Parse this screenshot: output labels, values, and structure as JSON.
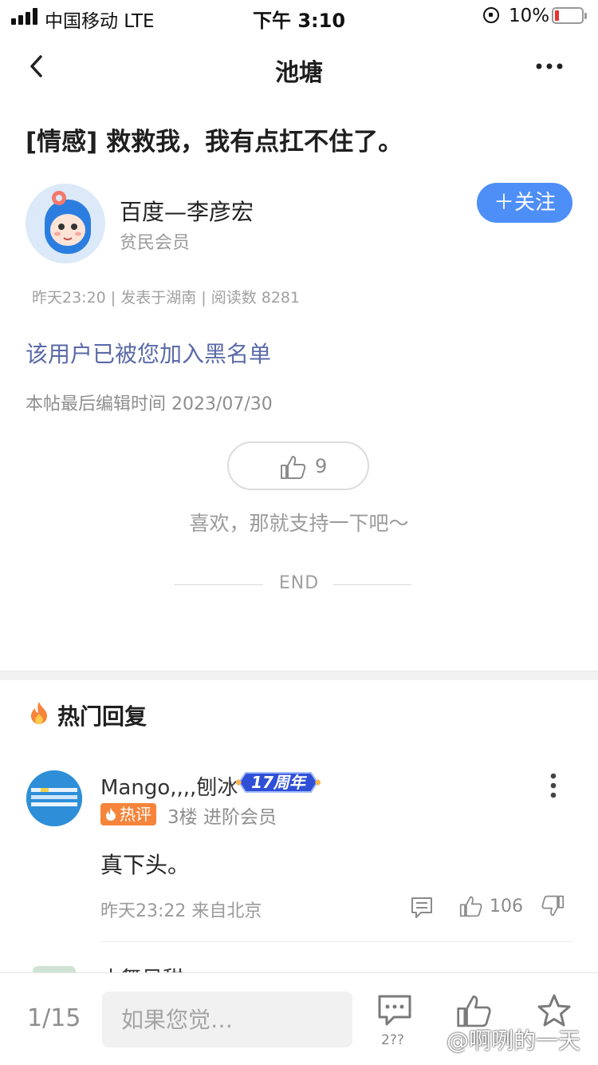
{
  "status_bar": {
    "carrier": "中国移动  LTE",
    "time": "下午 3:10",
    "battery_percent": "10%"
  },
  "nav": {
    "title": "池塘"
  },
  "post": {
    "title": "[情感] 救救我，我有点扛不住了。",
    "author_name": "百度—李彦宏",
    "author_level": "贫民会员",
    "follow_label": "＋关注",
    "meta": "昨天23:20 | 发表于湖南 | 阅读数 8281",
    "blacklist_notice": "该用户已被您加入黑名单",
    "edit_time": "本帖最后编辑时间 2023/07/30",
    "like_count": "9",
    "like_hint": "喜欢，那就支持一下吧～",
    "end_label": "END"
  },
  "hot_replies": {
    "title": "热门回复",
    "items": [
      {
        "name": "Mango,,,,刨冰",
        "badge": "17周年",
        "hot_tag": "热评",
        "floor_level": "3楼  进阶会员",
        "text": "真下头。",
        "time_location": "昨天23:22 来自北京",
        "like_count": "106"
      }
    ],
    "peek_name": "小舞风甜"
  },
  "bottom_bar": {
    "page": "1/15",
    "input_placeholder": "如果您觉…",
    "comment_count": "2??"
  },
  "watermark": "@啊咧的一天",
  "colors": {
    "accent_blue": "#4e8ef7",
    "hot_orange": "#f6843a",
    "blacklist_text": "#5b6aa8"
  }
}
